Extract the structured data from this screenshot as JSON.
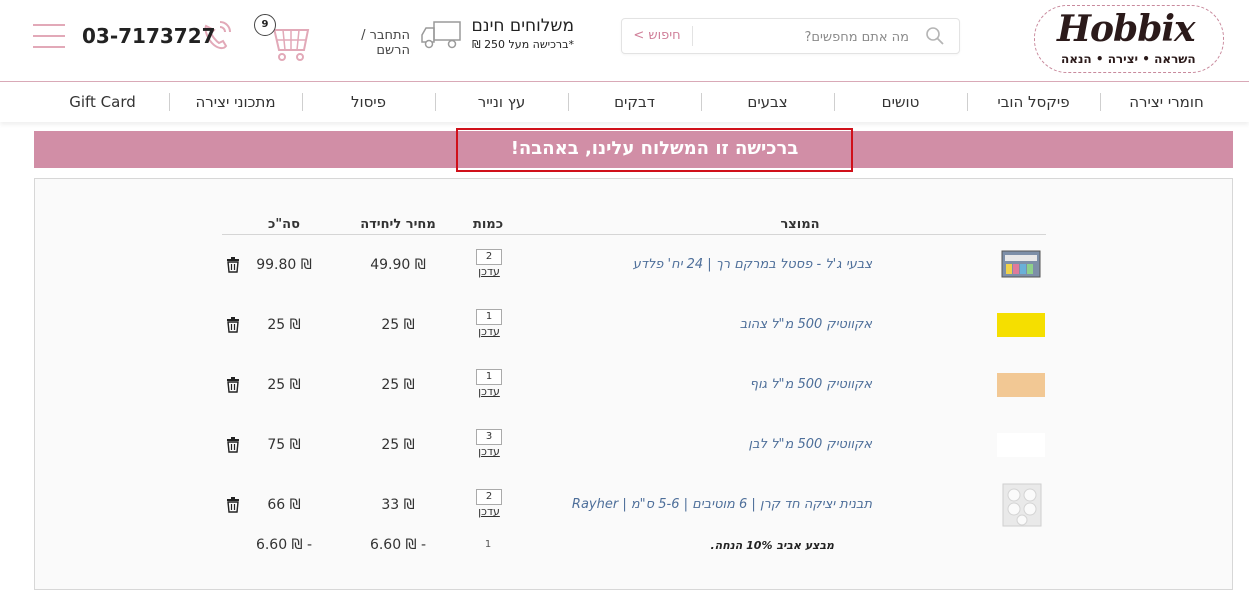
{
  "header": {
    "logo_word": "Hobbix",
    "logo_tagline": "השראה • יצירה • הנאה",
    "search_placeholder": "מה אתם מחפשים?",
    "search_button": "חיפוש >",
    "shipping_title": "משלוחים חינם",
    "shipping_sub": "*ברכישה מעל 250 ₪",
    "login_link": "התחבר / הרשם",
    "cart_count": "9",
    "phone": "03-7173727"
  },
  "nav": {
    "items": [
      "חומרי יצירה",
      "פיקסל הובי",
      "טושים",
      "צבעים",
      "דבקים",
      "עץ ונייר",
      "פיסול",
      "מתכוני יצירה",
      "Gift Card"
    ]
  },
  "banner": {
    "text": "ברכישה זו המשלוח עלינו, באהבה!"
  },
  "cart": {
    "headers": {
      "product": "המוצר",
      "quantity": "כמות",
      "unit_price": "מחיר ליחידה",
      "total": "סה\"כ"
    },
    "update_label": "עדכן",
    "items": [
      {
        "name": "צבעי ג'ל - פסטל במרקם רך | 24 יח' פלדע",
        "qty": "2",
        "unit_price": "49.90 ₪",
        "total": "99.80 ₪",
        "image": "gel-pens-pack"
      },
      {
        "name": "אקווטיק 500 מ\"ל צהוב",
        "qty": "1",
        "unit_price": "25 ₪",
        "total": "25 ₪",
        "image": "swatch-yellow",
        "swatch_color": "#f5df00"
      },
      {
        "name": "אקווטיק 500 מ\"ל גוף",
        "qty": "1",
        "unit_price": "25 ₪",
        "total": "25 ₪",
        "image": "swatch-skin",
        "swatch_color": "#f2c894"
      },
      {
        "name": "אקווטיק 500 מ\"ל לבן",
        "qty": "3",
        "unit_price": "25 ₪",
        "total": "75 ₪",
        "image": "swatch-white",
        "swatch_color": "#ffffff"
      },
      {
        "name": "תבנית יציקה חד קרן | 6 מוטיבים | 5-6 ס\"מ | Rayher",
        "qty": "2",
        "unit_price": "33 ₪",
        "total": "66 ₪",
        "image": "unicorn-mold"
      }
    ],
    "promo": {
      "name": "מבצע אביב 10% הנחה.",
      "qty": "1",
      "unit_price": "6.60 ₪ -",
      "total": "6.60 ₪ -"
    }
  },
  "colors": {
    "accent_pink": "#d18ea6",
    "highlight_red": "#d0101a",
    "link_blue": "#4e6f9a"
  }
}
